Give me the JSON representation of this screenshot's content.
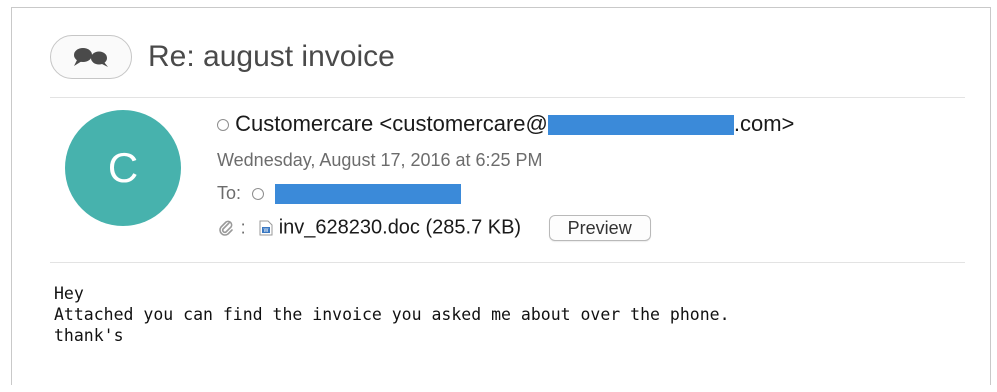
{
  "window": {
    "subject": "Re: august invoice"
  },
  "sender": {
    "avatar_letter": "C",
    "avatar_color": "#47b2ad",
    "name": "Customercare",
    "email_prefix": "<customercare@",
    "email_suffix": ".com>",
    "redaction_color": "#3b8ad9"
  },
  "message_meta": {
    "date": "Wednesday, August 17, 2016 at 6:25 PM",
    "to_label": "To:"
  },
  "attachment": {
    "separator": ":",
    "filename": "inv_628230.doc (285.7 KB)",
    "preview_label": "Preview"
  },
  "body": {
    "lines": [
      "Hey",
      "Attached you can find the invoice you asked me about over the phone.",
      "thank's"
    ]
  }
}
